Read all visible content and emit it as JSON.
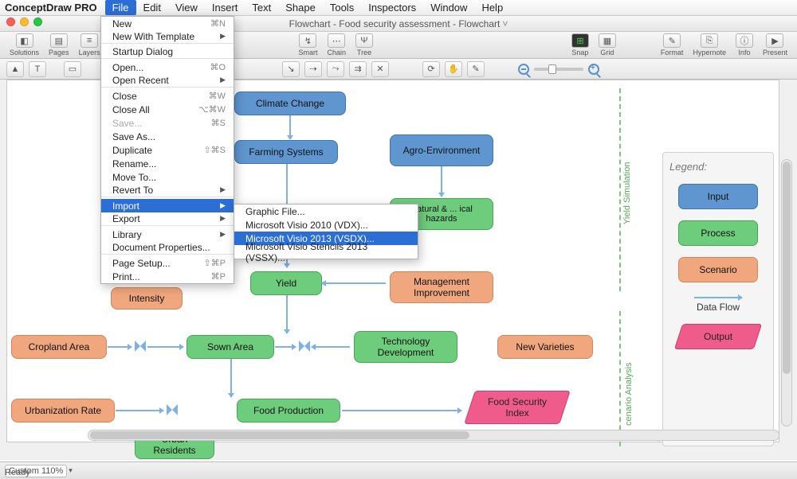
{
  "app_title": "ConceptDraw PRO",
  "menubar": [
    "File",
    "Edit",
    "View",
    "Insert",
    "Text",
    "Shape",
    "Tools",
    "Inspectors",
    "Window",
    "Help"
  ],
  "active_menu_index": 0,
  "doc_title": "Flowchart - Food security assessment - Flowchart",
  "toolbar1": {
    "left_groups": [
      {
        "label": "Solutions"
      },
      {
        "label": "Pages"
      },
      {
        "label": "Layers"
      }
    ],
    "center_groups": [
      {
        "label": "Smart"
      },
      {
        "label": "Chain"
      },
      {
        "label": "Tree"
      }
    ],
    "right_groups": [
      {
        "label": "Snap"
      },
      {
        "label": "Grid"
      }
    ],
    "far_right": [
      {
        "label": "Format"
      },
      {
        "label": "Hypernote"
      },
      {
        "label": "Info"
      },
      {
        "label": "Present"
      }
    ]
  },
  "file_menu": [
    {
      "label": "New",
      "shortcut": "⌘N"
    },
    {
      "label": "New With Template",
      "sub": true,
      "sep": true
    },
    {
      "label": "Startup Dialog",
      "sep": true
    },
    {
      "label": "Open...",
      "shortcut": "⌘O"
    },
    {
      "label": "Open Recent",
      "sub": true,
      "sep": true
    },
    {
      "label": "Close",
      "shortcut": "⌘W"
    },
    {
      "label": "Close All",
      "shortcut": "⌥⌘W"
    },
    {
      "label": "Save...",
      "shortcut": "⌘S",
      "disabled": true
    },
    {
      "label": "Save As..."
    },
    {
      "label": "Duplicate",
      "shortcut": "⇧⌘S"
    },
    {
      "label": "Rename..."
    },
    {
      "label": "Move To..."
    },
    {
      "label": "Revert To",
      "sub": true,
      "sep": true
    },
    {
      "label": "Import",
      "sub": true,
      "hl": true
    },
    {
      "label": "Export",
      "sub": true,
      "sep": true
    },
    {
      "label": "Library",
      "sub": true
    },
    {
      "label": "Document Properties...",
      "sep": true
    },
    {
      "label": "Page Setup...",
      "shortcut": "⇧⌘P"
    },
    {
      "label": "Print...",
      "shortcut": "⌘P"
    }
  ],
  "import_submenu": [
    {
      "label": "Graphic File..."
    },
    {
      "label": "Microsoft Visio 2010 (VDX)..."
    },
    {
      "label": "Microsoft Visio 2013 (VSDX)...",
      "hl": true
    },
    {
      "label": "Microsoft Visio Stencils 2013 (VSSX)..."
    }
  ],
  "nodes": {
    "climate": "Climate Change",
    "farming": "Farming Systems",
    "agro": "Agro-Environment",
    "natural": "Natural & ... ical hazards",
    "intensity": "Intensity",
    "yield": "Yield",
    "mgmt": "Management Improvement",
    "cropland": "Cropland Area",
    "sown": "Sown Area",
    "tech": "Technology Development",
    "newvar": "New Varieties",
    "urbrate": "Urbanization Rate",
    "foodprod": "Food Production",
    "fsi": "Food Security Index",
    "urbres": "Urban Residents"
  },
  "side_labels": {
    "yield": "Yield Simulation",
    "scenario": "cenario Analysis"
  },
  "legend": {
    "title": "Legend:",
    "input": "Input",
    "process": "Process",
    "scenario": "Scenario",
    "flow": "Data Flow",
    "output": "Output"
  },
  "status": {
    "zoom": "Custom 110%",
    "ready": "Ready"
  }
}
